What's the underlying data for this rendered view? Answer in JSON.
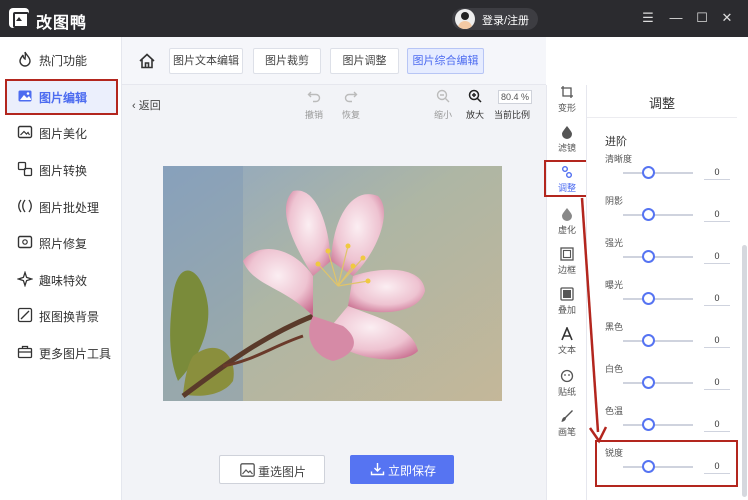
{
  "app": {
    "title": "改图鸭",
    "login": "登录/注册"
  },
  "window_controls": [
    "☰",
    "—",
    "☐",
    "✕"
  ],
  "sidebar": {
    "items": [
      {
        "label": "热门功能",
        "icon": "fire-icon"
      },
      {
        "label": "图片编辑",
        "icon": "image-edit-icon"
      },
      {
        "label": "图片美化",
        "icon": "image-beautify-icon"
      },
      {
        "label": "图片转换",
        "icon": "convert-icon"
      },
      {
        "label": "图片批处理",
        "icon": "batch-icon"
      },
      {
        "label": "照片修复",
        "icon": "repair-icon"
      },
      {
        "label": "趣味特效",
        "icon": "effects-icon"
      },
      {
        "label": "抠图换背景",
        "icon": "cutout-icon"
      },
      {
        "label": "更多图片工具",
        "icon": "toolbox-icon"
      }
    ]
  },
  "tabs": [
    "图片文本编辑",
    "图片裁剪",
    "图片调整",
    "图片综合编辑"
  ],
  "canvas": {
    "back": "返回",
    "undo": "撤销",
    "redo": "恢复",
    "zoom_out": "缩小",
    "zoom_in": "放大",
    "zoom_value": "80.4 %",
    "zoom_label": "当前比例",
    "reselect": "重选图片",
    "save": "立即保存"
  },
  "tool_strip": [
    "变形",
    "滤镜",
    "调整",
    "虚化",
    "边框",
    "叠加",
    "文本",
    "贴纸",
    "画笔"
  ],
  "panel": {
    "title": "调整",
    "section": "进阶",
    "sliders": [
      {
        "label": "清晰度",
        "value": "0"
      },
      {
        "label": "阴影",
        "value": "0"
      },
      {
        "label": "强光",
        "value": "0"
      },
      {
        "label": "曝光",
        "value": "0"
      },
      {
        "label": "黑色",
        "value": "0"
      },
      {
        "label": "白色",
        "value": "0"
      },
      {
        "label": "色温",
        "value": "0"
      },
      {
        "label": "锐度",
        "value": "0"
      }
    ]
  },
  "colors": {
    "accent": "#5674f2",
    "highlight": "#b3261e",
    "titlebar": "#2b2b2f"
  }
}
